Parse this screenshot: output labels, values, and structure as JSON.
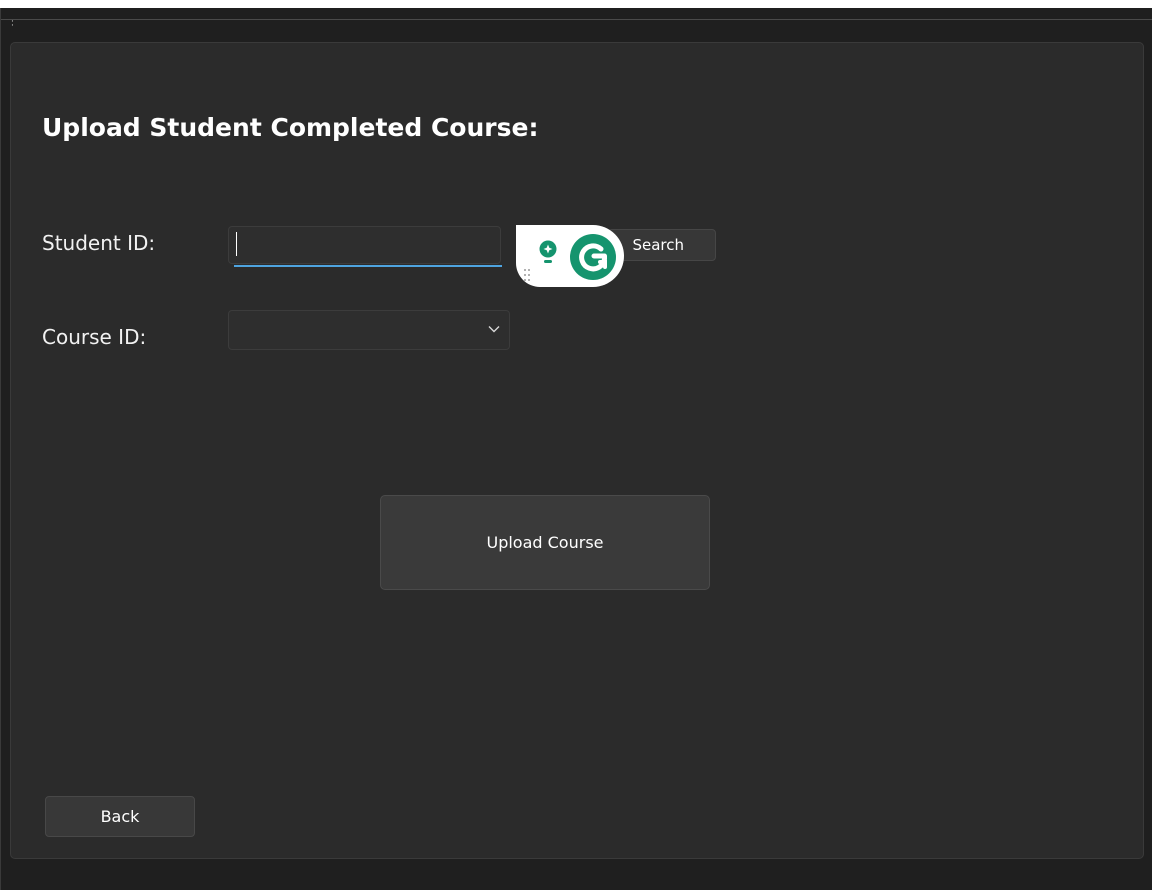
{
  "form": {
    "title": "Upload Student Completed Course:",
    "student_id_label": "Student ID:",
    "student_id_value": "",
    "search_label": "Search",
    "course_id_label": "Course ID:",
    "course_id_value": "",
    "upload_label": "Upload Course",
    "back_label": "Back"
  },
  "icons": {
    "titlebar_grip": "grip-dots-icon",
    "grammarly_suggestion": "lightbulb-icon",
    "grammarly_logo": "grammarly-logo-icon",
    "grammarly_drag": "drag-handle-icon",
    "dropdown": "chevron-down-icon"
  },
  "colors": {
    "window_background": "#1f1f1f",
    "panel_background": "#2b2b2b",
    "focus_accent": "#4ea4e0",
    "grammarly_green": "#15946e",
    "text": "#ffffff"
  }
}
